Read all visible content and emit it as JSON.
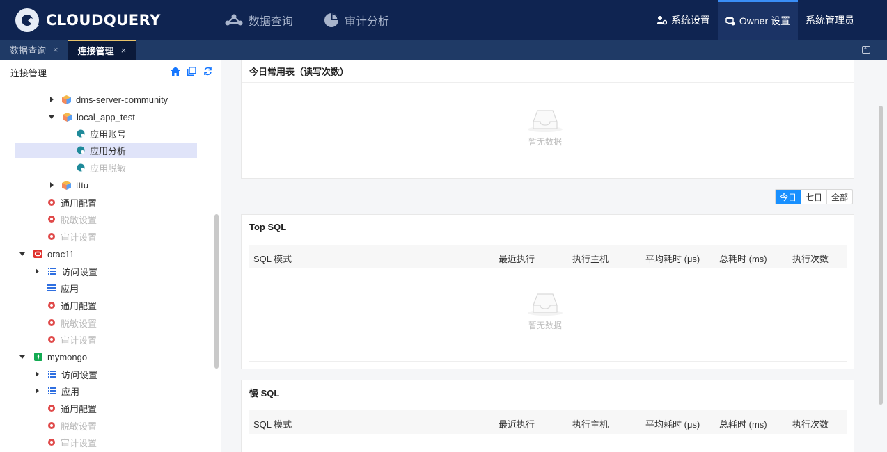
{
  "header": {
    "logo_text": "CLOUDQUERY",
    "nav": [
      {
        "label": "数据查询",
        "icon": "data-query-icon"
      },
      {
        "label": "审计分析",
        "icon": "pie-chart-icon"
      }
    ],
    "right": [
      {
        "label": "系统设置",
        "icon": "users-settings-icon"
      },
      {
        "label": "Owner 设置",
        "icon": "owner-settings-icon",
        "active": true
      },
      {
        "label": "系统管理员"
      }
    ]
  },
  "tabs": [
    {
      "label": "数据查询",
      "active": false
    },
    {
      "label": "连接管理",
      "active": true
    }
  ],
  "sidebar": {
    "title": "连接管理",
    "tree": [
      {
        "label": "dms-server-community",
        "icon": "cube-icon"
      },
      {
        "label": "local_app_test",
        "icon": "cube-icon"
      },
      {
        "label": "应用账号",
        "icon": "app-node-icon"
      },
      {
        "label": "应用分析",
        "icon": "app-node-icon",
        "selected": true
      },
      {
        "label": "应用脱敏",
        "icon": "app-node-icon",
        "disabled": true
      },
      {
        "label": "tttu",
        "icon": "cube-icon"
      },
      {
        "label": "通用配置",
        "icon": "gear-icon"
      },
      {
        "label": "脱敏设置",
        "icon": "gear-icon",
        "disabled": true
      },
      {
        "label": "审计设置",
        "icon": "gear-icon",
        "disabled": true
      },
      {
        "label": "orac11",
        "icon": "oracle-icon"
      },
      {
        "label": "访问设置",
        "icon": "list-icon"
      },
      {
        "label": "应用",
        "icon": "list-icon"
      },
      {
        "label": "通用配置",
        "icon": "gear-icon"
      },
      {
        "label": "脱敏设置",
        "icon": "gear-icon",
        "disabled": true
      },
      {
        "label": "审计设置",
        "icon": "gear-icon",
        "disabled": true
      },
      {
        "label": "mymongo",
        "icon": "mongo-icon"
      },
      {
        "label": "访问设置",
        "icon": "list-icon"
      },
      {
        "label": "应用",
        "icon": "list-icon"
      },
      {
        "label": "通用配置",
        "icon": "gear-icon"
      },
      {
        "label": "脱敏设置",
        "icon": "gear-icon",
        "disabled": true
      },
      {
        "label": "审计设置",
        "icon": "gear-icon",
        "disabled": true
      }
    ]
  },
  "main": {
    "common_tables": {
      "title": "今日常用表（读写次数）",
      "empty": "暂无数据"
    },
    "range": [
      "今日",
      "七日",
      "全部"
    ],
    "range_selected": "今日",
    "top_sql": {
      "title": "Top SQL",
      "columns": [
        "SQL 模式",
        "最近执行",
        "执行主机",
        "平均耗时 (μs)",
        "总耗时 (ms)",
        "执行次数"
      ],
      "empty": "暂无数据"
    },
    "slow_sql": {
      "title": "慢 SQL",
      "columns": [
        "SQL 模式",
        "最近执行",
        "执行主机",
        "平均耗时 (μs)",
        "总耗时 (ms)",
        "执行次数"
      ]
    }
  },
  "colors": {
    "header_bg": "#0f2451",
    "tab_bg": "#1f3a66",
    "accent": "#1890ff",
    "selected_bg": "#e0e4f9"
  }
}
